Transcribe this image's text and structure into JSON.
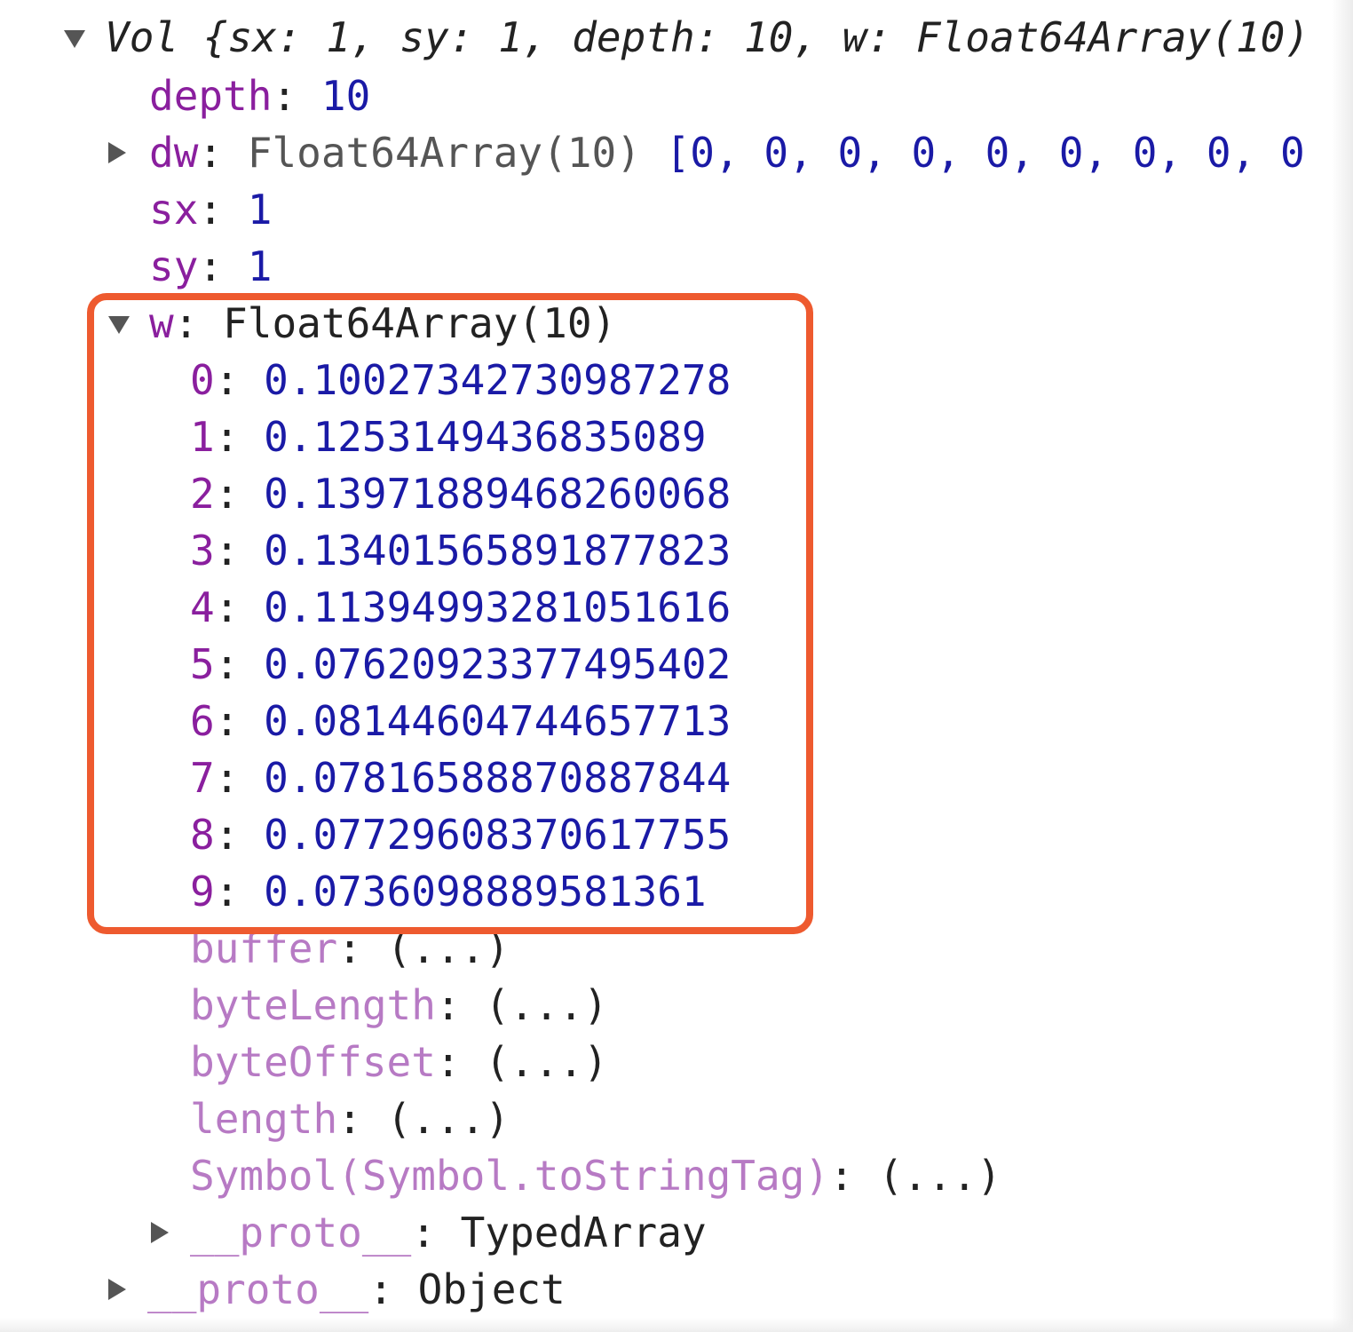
{
  "root": {
    "summary_text": "Vol {sx: 1, sy: 1, depth: 10, w: Float64Array(10)"
  },
  "depth": {
    "key": "depth",
    "value": "10"
  },
  "dw": {
    "key": "dw",
    "type": "Float64Array(10)",
    "preview": "[0, 0, 0, 0, 0, 0, 0, 0, 0"
  },
  "sx": {
    "key": "sx",
    "value": "1"
  },
  "sy": {
    "key": "sy",
    "value": "1"
  },
  "w": {
    "key": "w",
    "type": "Float64Array(10)",
    "items": [
      {
        "index": "0",
        "value": "0.10027342730987278"
      },
      {
        "index": "1",
        "value": "0.1253149436835089"
      },
      {
        "index": "2",
        "value": "0.13971889468260068"
      },
      {
        "index": "3",
        "value": "0.13401565891877823"
      },
      {
        "index": "4",
        "value": "0.11394993281051616"
      },
      {
        "index": "5",
        "value": "0.07620923377495402"
      },
      {
        "index": "6",
        "value": "0.08144604744657713"
      },
      {
        "index": "7",
        "value": "0.07816588870887844"
      },
      {
        "index": "8",
        "value": "0.07729608370617755"
      },
      {
        "index": "9",
        "value": "0.0736098889581361"
      }
    ],
    "accessors": [
      {
        "key": "buffer",
        "value": "(...)"
      },
      {
        "key": "byteLength",
        "value": "(...)"
      },
      {
        "key": "byteOffset",
        "value": "(...)"
      },
      {
        "key": "length",
        "value": "(...)"
      },
      {
        "key": "Symbol(Symbol.toStringTag)",
        "value": "(...)"
      }
    ],
    "proto": {
      "key": "__proto__",
      "value": "TypedArray"
    }
  },
  "proto": {
    "key": "__proto__",
    "value": "Object"
  },
  "colors": {
    "key": "#8a1f9e",
    "key_dim": "#b77ac4",
    "number": "#1a1aa6",
    "highlight": "#ee5a2f"
  }
}
